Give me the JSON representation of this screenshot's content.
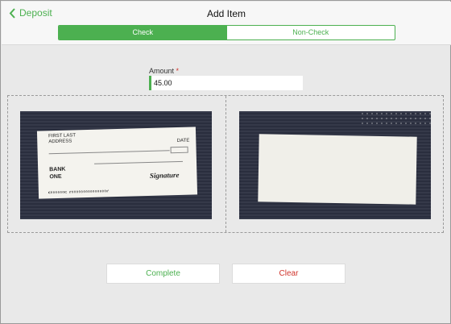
{
  "nav": {
    "back_label": "Deposit",
    "title": "Add Item"
  },
  "segments": [
    {
      "label": "Check",
      "active": true
    },
    {
      "label": "Non-Check",
      "active": false
    }
  ],
  "amount": {
    "label": "Amount",
    "required_mark": "*",
    "value": "45.00"
  },
  "check_front": {
    "payer": "FIRST LAST ADDRESS",
    "date_label": "DATE",
    "bank_name": "BANK ONE",
    "signature": "Signature",
    "micr": "⑆000000⑆ ⑈000000000000000⑈"
  },
  "check_back": {},
  "buttons": {
    "complete": "Complete",
    "clear": "Clear"
  },
  "colors": {
    "accent": "#4cb050",
    "danger": "#d0342c"
  }
}
